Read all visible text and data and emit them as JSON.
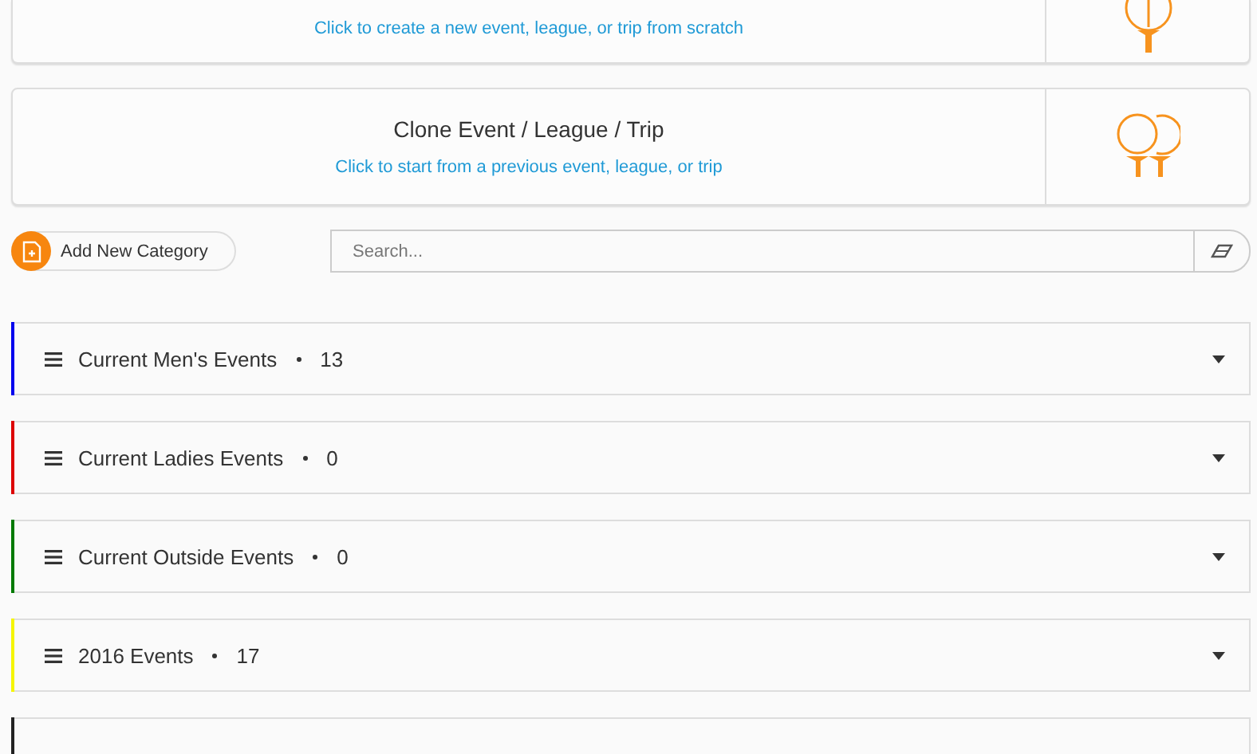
{
  "actions": [
    {
      "kind": "new",
      "subtitle": "Click to create a new event, league, or trip from scratch"
    },
    {
      "kind": "clone",
      "title": "Clone Event / League / Trip",
      "subtitle": "Click to start from a previous event, league, or trip"
    }
  ],
  "add_button": {
    "label": "Add New Category"
  },
  "search": {
    "placeholder": "Search..."
  },
  "categories": [
    {
      "name": "Current Men's Events",
      "count": "13",
      "color": "#0000ee"
    },
    {
      "name": "Current Ladies Events",
      "count": "0",
      "color": "#dd0000"
    },
    {
      "name": "Current Outside Events",
      "count": "0",
      "color": "#007a00"
    },
    {
      "name": "2016 Events",
      "count": "17",
      "color": "#f5f500"
    },
    {
      "color": "#222222"
    }
  ]
}
